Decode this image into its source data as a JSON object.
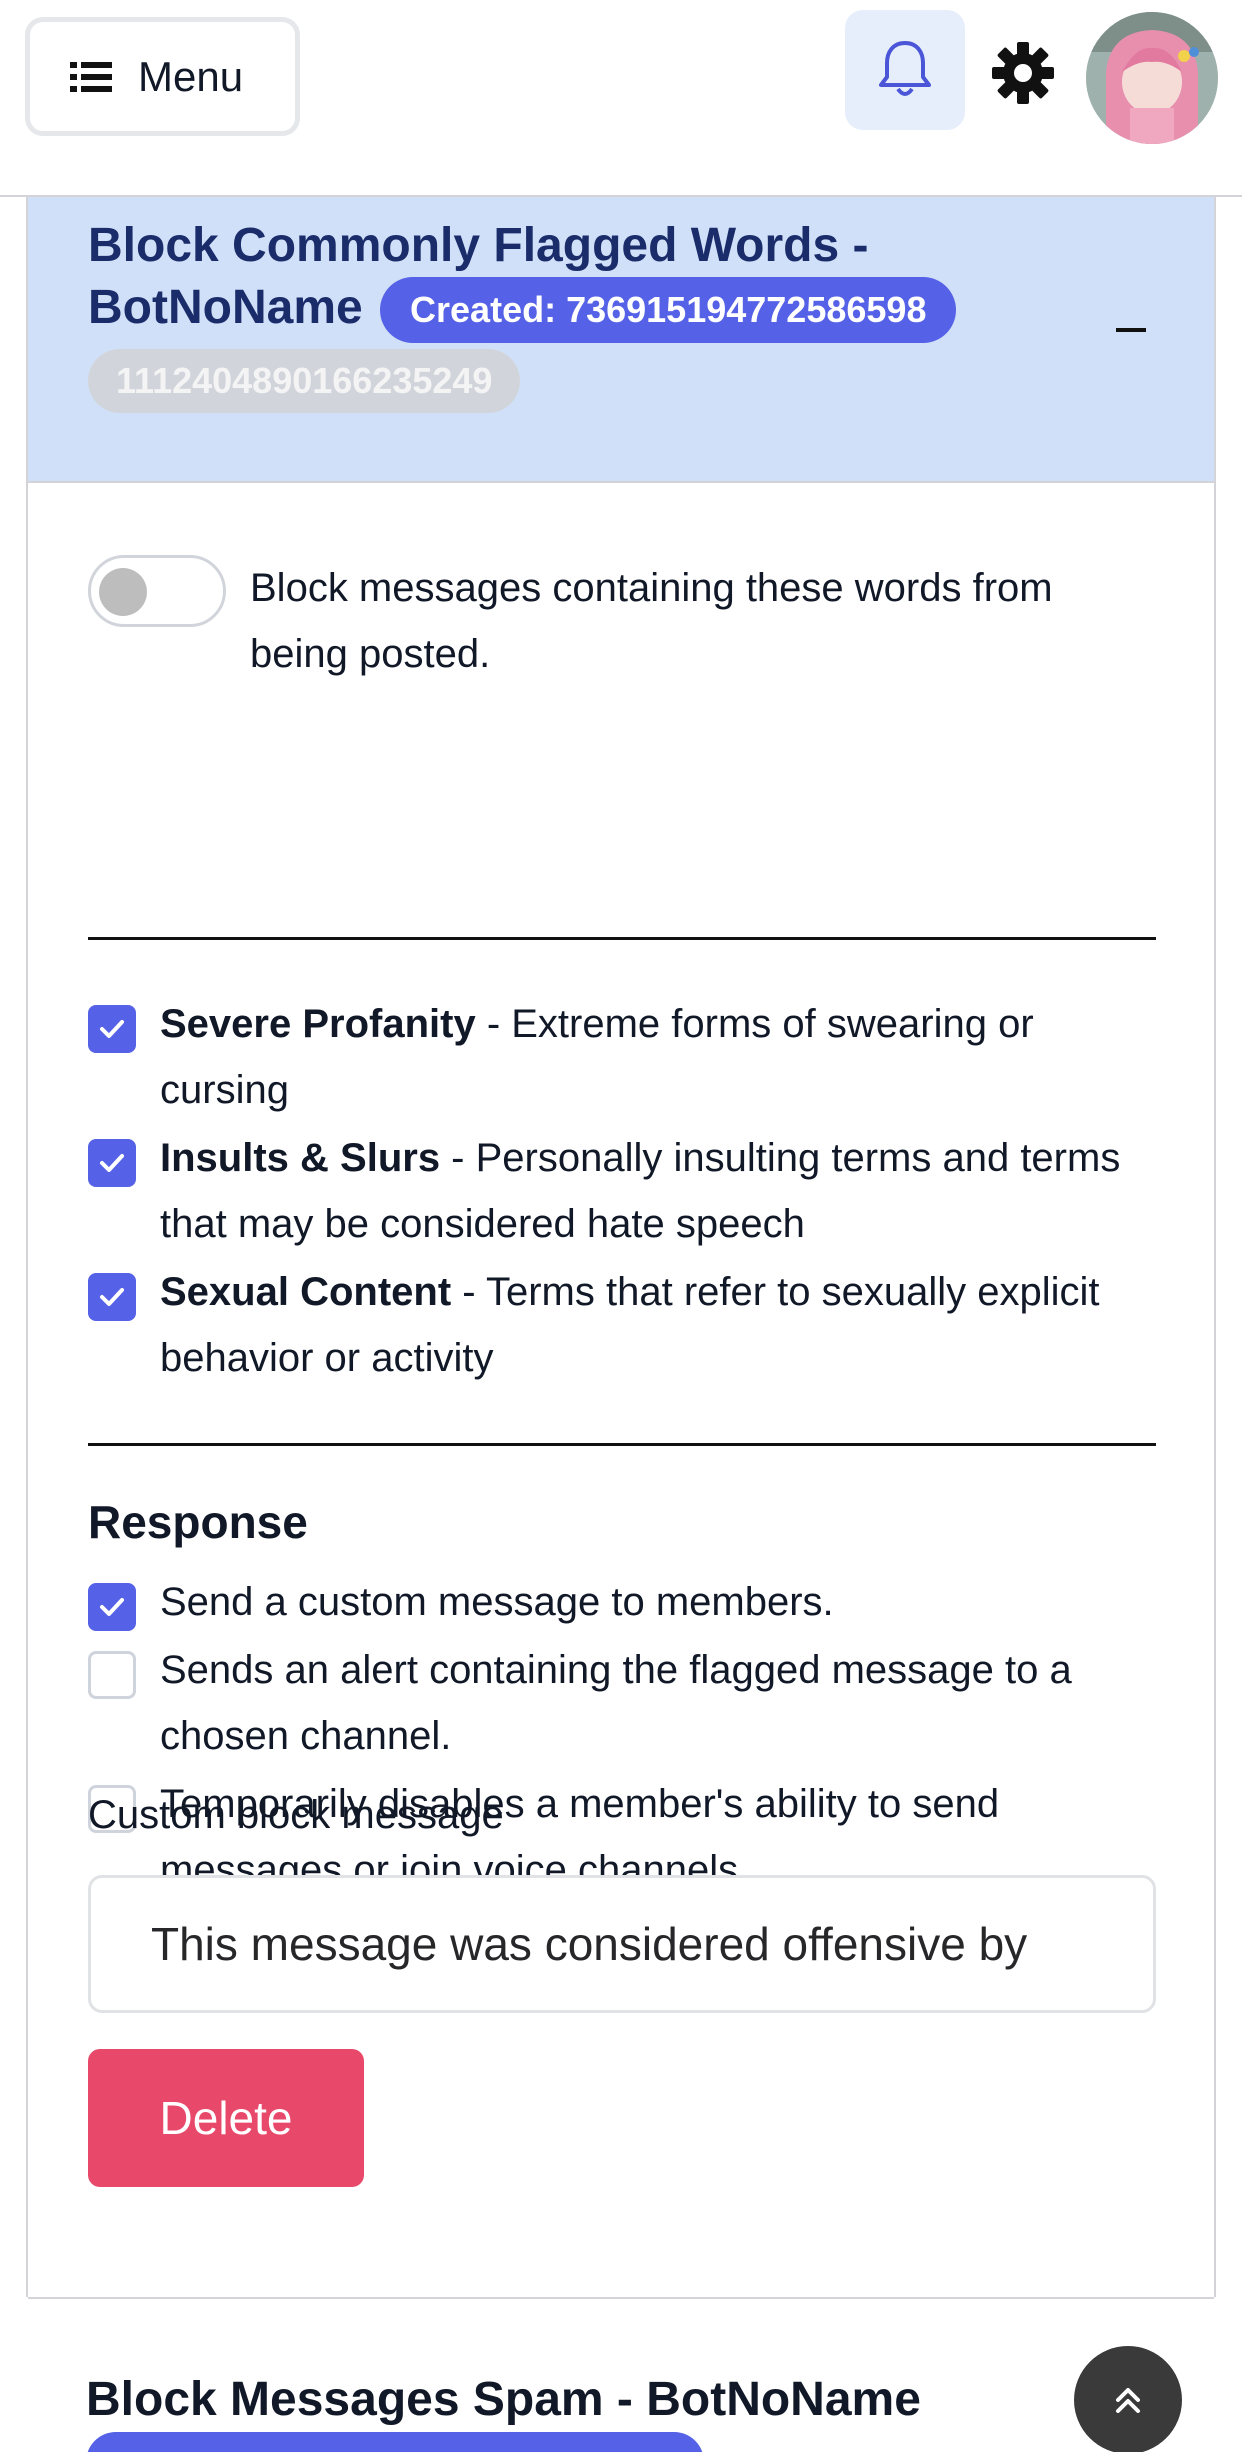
{
  "topbar": {
    "menu_label": "Menu",
    "icons": {
      "menu": "list-icon",
      "notifications": "bell-icon",
      "settings": "gear-icon",
      "profile": "avatar"
    }
  },
  "rule": {
    "title": "Block Commonly Flagged Words - BotNoName",
    "created_badge": "Created: 736915194772586598",
    "id_badge": "1112404890166235249",
    "toggle_text": "Block messages containing these words from being posted.",
    "toggle_on": false,
    "categories": [
      {
        "name": "Severe Profanity",
        "desc": " - Extreme forms of swearing or cursing",
        "checked": true
      },
      {
        "name": "Insults & Slurs",
        "desc": " - Personally insulting terms and terms that may be considered hate speech",
        "checked": true
      },
      {
        "name": "Sexual Content",
        "desc": " - Terms that refer to sexually explicit behavior or activity",
        "checked": true
      }
    ],
    "response_heading": "Response",
    "responses": [
      {
        "text": "Send a custom message to members.",
        "checked": true
      },
      {
        "text": "Sends an alert containing the flagged message to a chosen channel.",
        "checked": false
      },
      {
        "text": "Temporarily disables a member's ability to send messages or join voice channels.",
        "checked": false
      }
    ],
    "custom_message_label": "Custom block message",
    "custom_message_value": "This message was considered offensive by",
    "delete_label": "Delete"
  },
  "next_rule": {
    "title": "Block Messages Spam - BotNoName"
  },
  "colors": {
    "accent": "#5561e6",
    "header_bg": "#d0e0f8",
    "title": "#1b2c6b",
    "danger": "#e8496a"
  }
}
